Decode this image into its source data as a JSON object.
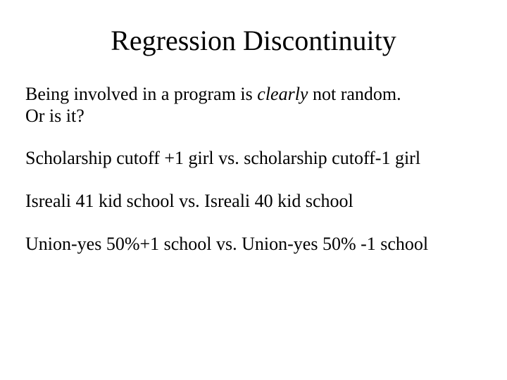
{
  "title": "Regression Discontinuity",
  "intro": {
    "line1_pre": "Being involved in a program is ",
    "line1_italic": "clearly",
    "line1_post": " not random.",
    "line2": "Or is it?"
  },
  "examples": {
    "scholarship": "Scholarship cutoff +1 girl vs. scholarship cutoff-1 girl",
    "israeli": "Isreali 41 kid school vs. Isreali 40 kid school",
    "union": "Union-yes 50%+1 school vs. Union-yes 50% -1 school"
  }
}
